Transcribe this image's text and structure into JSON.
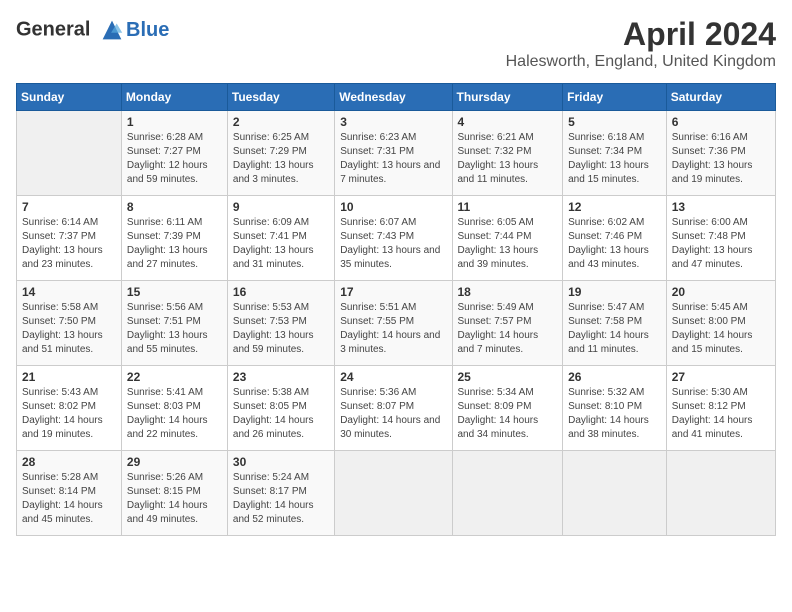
{
  "logo": {
    "line1": "General",
    "line2": "Blue"
  },
  "title": "April 2024",
  "location": "Halesworth, England, United Kingdom",
  "days_header": [
    "Sunday",
    "Monday",
    "Tuesday",
    "Wednesday",
    "Thursday",
    "Friday",
    "Saturday"
  ],
  "weeks": [
    [
      {
        "day": "",
        "sunrise": "",
        "sunset": "",
        "daylight": ""
      },
      {
        "day": "1",
        "sunrise": "Sunrise: 6:28 AM",
        "sunset": "Sunset: 7:27 PM",
        "daylight": "Daylight: 12 hours and 59 minutes."
      },
      {
        "day": "2",
        "sunrise": "Sunrise: 6:25 AM",
        "sunset": "Sunset: 7:29 PM",
        "daylight": "Daylight: 13 hours and 3 minutes."
      },
      {
        "day": "3",
        "sunrise": "Sunrise: 6:23 AM",
        "sunset": "Sunset: 7:31 PM",
        "daylight": "Daylight: 13 hours and 7 minutes."
      },
      {
        "day": "4",
        "sunrise": "Sunrise: 6:21 AM",
        "sunset": "Sunset: 7:32 PM",
        "daylight": "Daylight: 13 hours and 11 minutes."
      },
      {
        "day": "5",
        "sunrise": "Sunrise: 6:18 AM",
        "sunset": "Sunset: 7:34 PM",
        "daylight": "Daylight: 13 hours and 15 minutes."
      },
      {
        "day": "6",
        "sunrise": "Sunrise: 6:16 AM",
        "sunset": "Sunset: 7:36 PM",
        "daylight": "Daylight: 13 hours and 19 minutes."
      }
    ],
    [
      {
        "day": "7",
        "sunrise": "Sunrise: 6:14 AM",
        "sunset": "Sunset: 7:37 PM",
        "daylight": "Daylight: 13 hours and 23 minutes."
      },
      {
        "day": "8",
        "sunrise": "Sunrise: 6:11 AM",
        "sunset": "Sunset: 7:39 PM",
        "daylight": "Daylight: 13 hours and 27 minutes."
      },
      {
        "day": "9",
        "sunrise": "Sunrise: 6:09 AM",
        "sunset": "Sunset: 7:41 PM",
        "daylight": "Daylight: 13 hours and 31 minutes."
      },
      {
        "day": "10",
        "sunrise": "Sunrise: 6:07 AM",
        "sunset": "Sunset: 7:43 PM",
        "daylight": "Daylight: 13 hours and 35 minutes."
      },
      {
        "day": "11",
        "sunrise": "Sunrise: 6:05 AM",
        "sunset": "Sunset: 7:44 PM",
        "daylight": "Daylight: 13 hours and 39 minutes."
      },
      {
        "day": "12",
        "sunrise": "Sunrise: 6:02 AM",
        "sunset": "Sunset: 7:46 PM",
        "daylight": "Daylight: 13 hours and 43 minutes."
      },
      {
        "day": "13",
        "sunrise": "Sunrise: 6:00 AM",
        "sunset": "Sunset: 7:48 PM",
        "daylight": "Daylight: 13 hours and 47 minutes."
      }
    ],
    [
      {
        "day": "14",
        "sunrise": "Sunrise: 5:58 AM",
        "sunset": "Sunset: 7:50 PM",
        "daylight": "Daylight: 13 hours and 51 minutes."
      },
      {
        "day": "15",
        "sunrise": "Sunrise: 5:56 AM",
        "sunset": "Sunset: 7:51 PM",
        "daylight": "Daylight: 13 hours and 55 minutes."
      },
      {
        "day": "16",
        "sunrise": "Sunrise: 5:53 AM",
        "sunset": "Sunset: 7:53 PM",
        "daylight": "Daylight: 13 hours and 59 minutes."
      },
      {
        "day": "17",
        "sunrise": "Sunrise: 5:51 AM",
        "sunset": "Sunset: 7:55 PM",
        "daylight": "Daylight: 14 hours and 3 minutes."
      },
      {
        "day": "18",
        "sunrise": "Sunrise: 5:49 AM",
        "sunset": "Sunset: 7:57 PM",
        "daylight": "Daylight: 14 hours and 7 minutes."
      },
      {
        "day": "19",
        "sunrise": "Sunrise: 5:47 AM",
        "sunset": "Sunset: 7:58 PM",
        "daylight": "Daylight: 14 hours and 11 minutes."
      },
      {
        "day": "20",
        "sunrise": "Sunrise: 5:45 AM",
        "sunset": "Sunset: 8:00 PM",
        "daylight": "Daylight: 14 hours and 15 minutes."
      }
    ],
    [
      {
        "day": "21",
        "sunrise": "Sunrise: 5:43 AM",
        "sunset": "Sunset: 8:02 PM",
        "daylight": "Daylight: 14 hours and 19 minutes."
      },
      {
        "day": "22",
        "sunrise": "Sunrise: 5:41 AM",
        "sunset": "Sunset: 8:03 PM",
        "daylight": "Daylight: 14 hours and 22 minutes."
      },
      {
        "day": "23",
        "sunrise": "Sunrise: 5:38 AM",
        "sunset": "Sunset: 8:05 PM",
        "daylight": "Daylight: 14 hours and 26 minutes."
      },
      {
        "day": "24",
        "sunrise": "Sunrise: 5:36 AM",
        "sunset": "Sunset: 8:07 PM",
        "daylight": "Daylight: 14 hours and 30 minutes."
      },
      {
        "day": "25",
        "sunrise": "Sunrise: 5:34 AM",
        "sunset": "Sunset: 8:09 PM",
        "daylight": "Daylight: 14 hours and 34 minutes."
      },
      {
        "day": "26",
        "sunrise": "Sunrise: 5:32 AM",
        "sunset": "Sunset: 8:10 PM",
        "daylight": "Daylight: 14 hours and 38 minutes."
      },
      {
        "day": "27",
        "sunrise": "Sunrise: 5:30 AM",
        "sunset": "Sunset: 8:12 PM",
        "daylight": "Daylight: 14 hours and 41 minutes."
      }
    ],
    [
      {
        "day": "28",
        "sunrise": "Sunrise: 5:28 AM",
        "sunset": "Sunset: 8:14 PM",
        "daylight": "Daylight: 14 hours and 45 minutes."
      },
      {
        "day": "29",
        "sunrise": "Sunrise: 5:26 AM",
        "sunset": "Sunset: 8:15 PM",
        "daylight": "Daylight: 14 hours and 49 minutes."
      },
      {
        "day": "30",
        "sunrise": "Sunrise: 5:24 AM",
        "sunset": "Sunset: 8:17 PM",
        "daylight": "Daylight: 14 hours and 52 minutes."
      },
      {
        "day": "",
        "sunrise": "",
        "sunset": "",
        "daylight": ""
      },
      {
        "day": "",
        "sunrise": "",
        "sunset": "",
        "daylight": ""
      },
      {
        "day": "",
        "sunrise": "",
        "sunset": "",
        "daylight": ""
      },
      {
        "day": "",
        "sunrise": "",
        "sunset": "",
        "daylight": ""
      }
    ]
  ]
}
